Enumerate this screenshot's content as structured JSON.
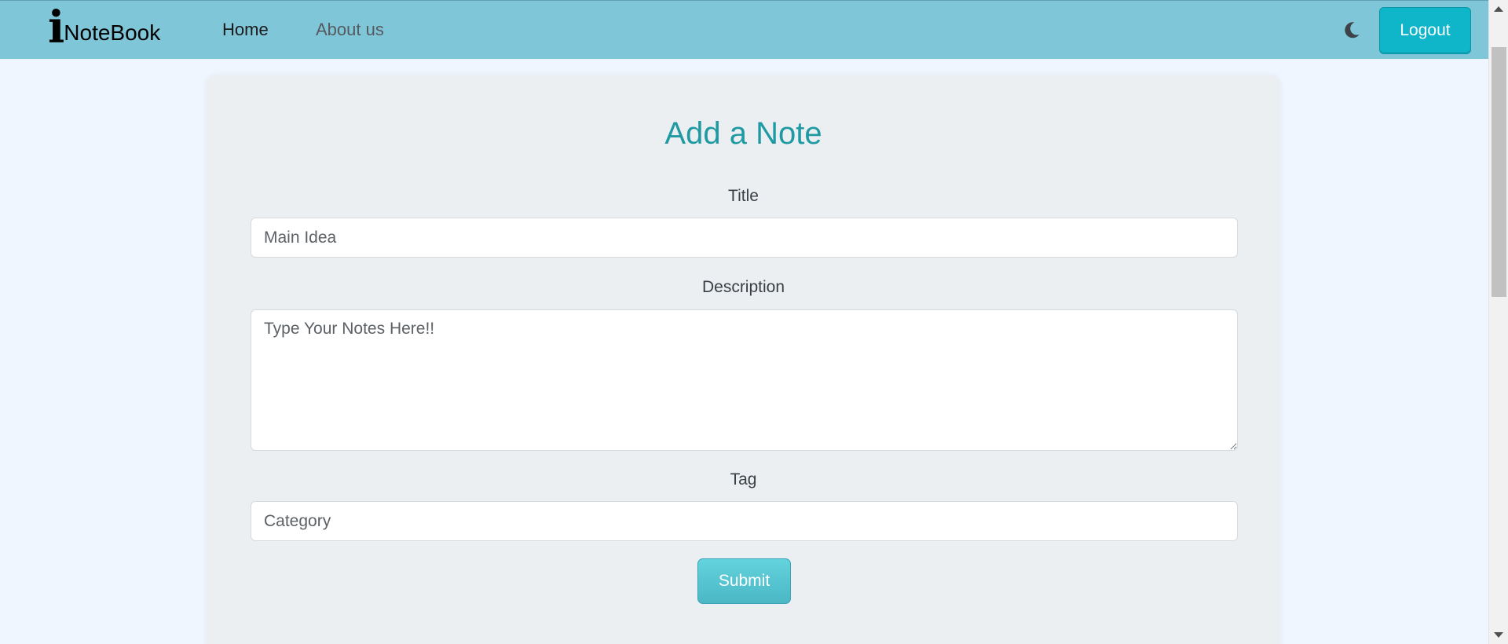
{
  "navbar": {
    "brand_i": "i",
    "brand_text": "NoteBook",
    "links": [
      {
        "label": "Home",
        "active": true
      },
      {
        "label": "About us",
        "active": false
      }
    ],
    "theme_toggle_icon": "moon-icon",
    "logout_label": "Logout",
    "background_color": "#80c6d9",
    "logout_color": "#0fb5c9"
  },
  "form": {
    "heading": "Add a Note",
    "title_label": "Title",
    "title_placeholder": "Main Idea",
    "description_label": "Description",
    "description_placeholder": "Type Your Notes Here!!",
    "tag_label": "Tag",
    "tag_placeholder": "Category",
    "submit_label": "Submit",
    "heading_color": "#1f9aa3"
  }
}
